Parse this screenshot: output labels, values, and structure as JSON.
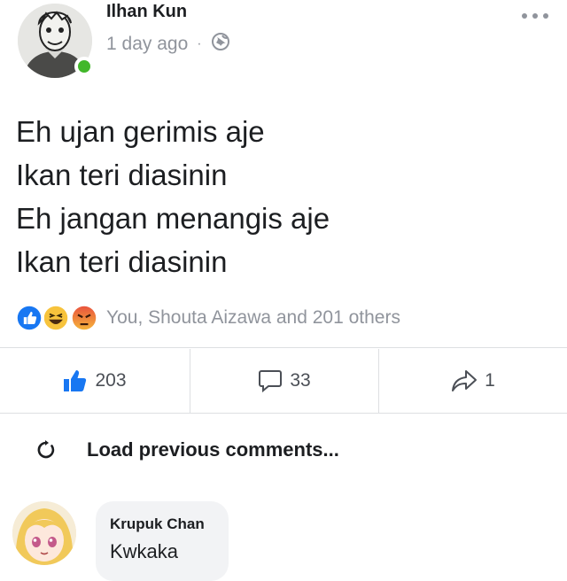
{
  "post": {
    "author": "Ilhan Kun",
    "timestamp": "1 day ago",
    "separator": "·",
    "privacy_icon": "globe-icon",
    "more_icon": "ellipsis-icon",
    "lines": [
      "Eh ujan gerimis aje",
      "Ikan teri diasinin",
      "Eh jangan menangis aje",
      "Ikan teri diasinin"
    ],
    "reactions": {
      "icons": [
        "like-icon",
        "haha-icon",
        "angry-icon"
      ],
      "summary": "You, Shouta Aizawa and 201 others"
    }
  },
  "actions": {
    "like_count": "203",
    "comment_count": "33",
    "share_count": "1"
  },
  "comments": {
    "load_previous": "Load previous comments...",
    "items": [
      {
        "author": "Krupuk Chan",
        "text": "Kwkaka"
      }
    ]
  },
  "colors": {
    "like_blue": "#1877f2",
    "online_green": "#42b72a",
    "muted_text": "#90949c",
    "bubble_bg": "#f2f3f5"
  }
}
